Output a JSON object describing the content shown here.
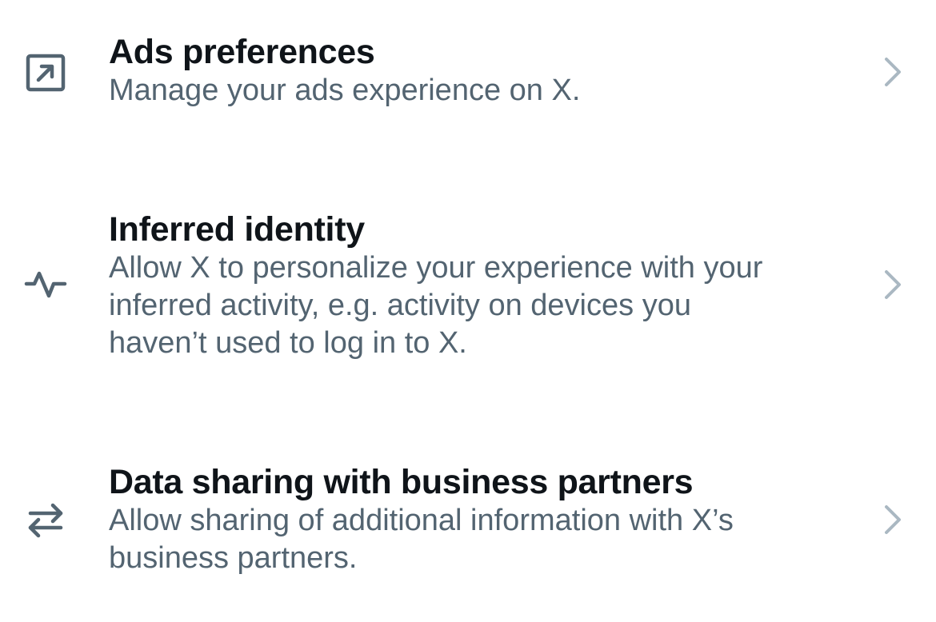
{
  "settings": {
    "items": [
      {
        "title": "Ads preferences",
        "description": "Manage your ads experience on X.",
        "icon": "external-arrow-box-icon"
      },
      {
        "title": "Inferred identity",
        "description_lines": [
          "Allow X to personalize your experience with your",
          "inferred activity, e.g. activity on devices you",
          "haven’t used to log in to X."
        ],
        "icon": "activity-pulse-icon"
      },
      {
        "title": "Data sharing with business partners",
        "description_lines": [
          "Allow sharing of additional information with X’s",
          "business partners."
        ],
        "icon": "swap-arrows-icon"
      }
    ]
  },
  "colors": {
    "title": "#0f1419",
    "description": "#536471",
    "icon": "#536471",
    "chevron": "#aab8c2",
    "background": "#ffffff"
  }
}
